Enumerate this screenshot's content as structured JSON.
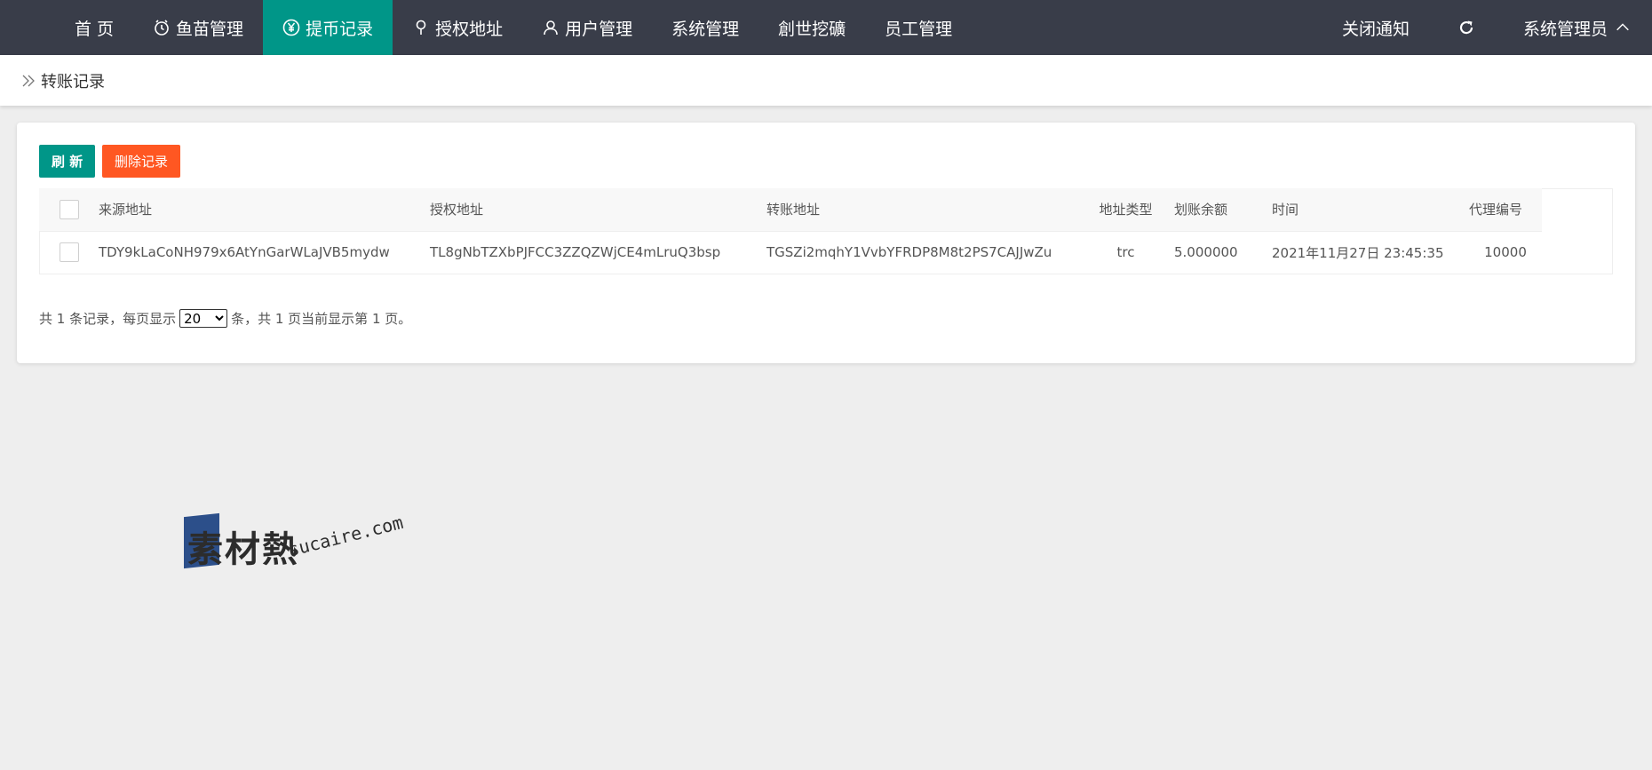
{
  "nav": {
    "items": [
      {
        "label": "首 页",
        "icon": "",
        "active": false
      },
      {
        "label": "鱼苗管理",
        "icon": "clock-icon",
        "active": false
      },
      {
        "label": "提币记录",
        "icon": "yen-circle-icon",
        "active": true
      },
      {
        "label": "授权地址",
        "icon": "pin-icon",
        "active": false
      },
      {
        "label": "用户管理",
        "icon": "user-icon",
        "active": false
      },
      {
        "label": "系统管理",
        "icon": "",
        "active": false
      },
      {
        "label": "創世挖礦",
        "icon": "",
        "active": false
      },
      {
        "label": "员工管理",
        "icon": "",
        "active": false
      }
    ],
    "notify_label": "关闭通知",
    "user_label": "系统管理员",
    "active_color": "#009688",
    "bar_color": "#393d49"
  },
  "breadcrumb": {
    "label": "转账记录"
  },
  "toolbar": {
    "refresh_label": "刷 新",
    "delete_label": "删除记录",
    "refresh_color": "#009688",
    "delete_color": "#ff5722"
  },
  "table": {
    "headers": [
      "来源地址",
      "授权地址",
      "转账地址",
      "地址类型",
      "划账余额",
      "时间",
      "代理编号"
    ],
    "rows": [
      {
        "source": "TDY9kLaCoNH979x6AtYnGarWLaJVB5mydw",
        "auth": "TL8gNbTZXbPJFCC3ZZQZWjCE4mLruQ3bsp",
        "transfer": "TGSZi2mqhY1VvbYFRDP8M8t2PS7CAJJwZu",
        "type": "trc",
        "balance": "5.000000",
        "time": "2021年11月27日 23:45:35",
        "agent": "10000"
      }
    ]
  },
  "pager": {
    "prefix": "共 1 条记录，每页显示",
    "page_size": "20",
    "suffix": "条，共 1 页当前显示第 1 页。"
  },
  "watermark": {
    "cn": "素材熱",
    "en": "sucaire.com"
  }
}
